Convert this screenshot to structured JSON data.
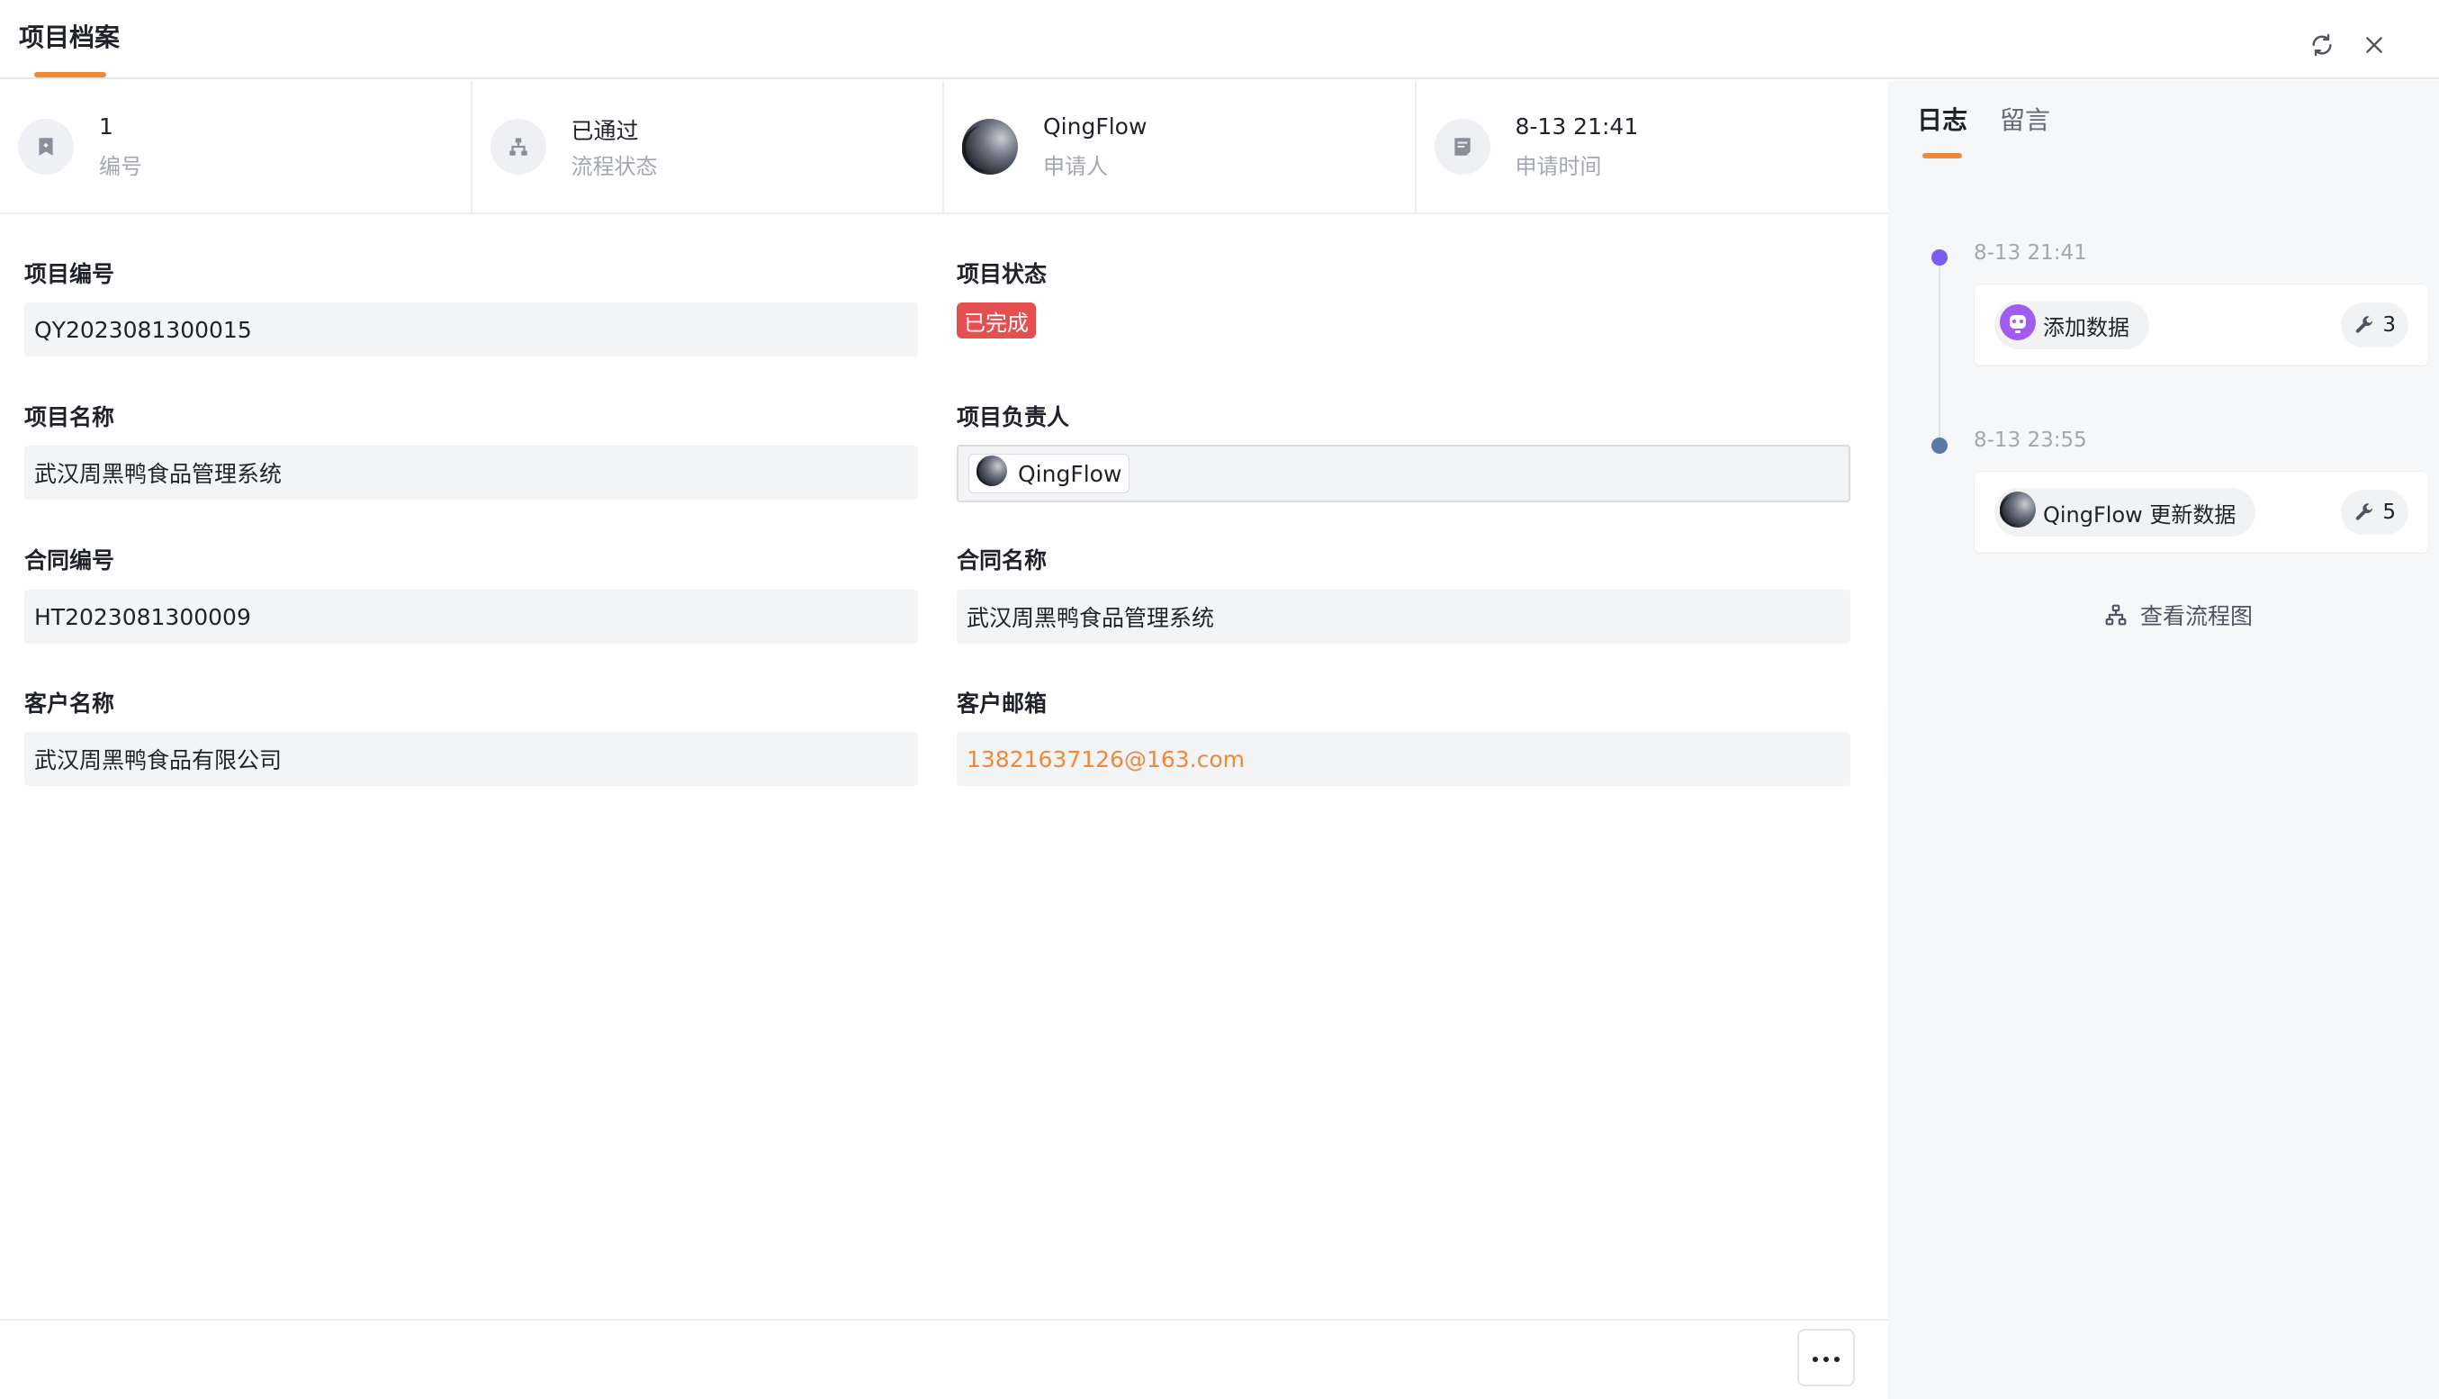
{
  "header": {
    "title": "项目档案",
    "refresh_icon": "refresh-icon",
    "close_icon": "close-icon"
  },
  "summary": [
    {
      "value": "1",
      "label": "编号",
      "icon": "tag-icon"
    },
    {
      "value": "已通过",
      "label": "流程状态",
      "icon": "flow-icon"
    },
    {
      "value": "QingFlow",
      "label": "申请人",
      "icon": "avatar"
    },
    {
      "value": "8-13 21:41",
      "label": "申请时间",
      "icon": "form-icon"
    }
  ],
  "fields": {
    "project_no": {
      "label": "项目编号",
      "value": "QY2023081300015"
    },
    "project_status": {
      "label": "项目状态",
      "value": "已完成"
    },
    "project_name": {
      "label": "项目名称",
      "value": "武汉周黑鸭食品管理系统"
    },
    "project_owner": {
      "label": "项目负责人",
      "value": "QingFlow"
    },
    "contract_no": {
      "label": "合同编号",
      "value": "HT2023081300009"
    },
    "contract_name": {
      "label": "合同名称",
      "value": "武汉周黑鸭食品管理系统"
    },
    "customer_name": {
      "label": "客户名称",
      "value": "武汉周黑鸭食品有限公司"
    },
    "customer_email": {
      "label": "客户邮箱",
      "value": "13821637126@163.com"
    }
  },
  "tabs": [
    {
      "label": "日志",
      "active": true
    },
    {
      "label": "留言",
      "active": false
    }
  ],
  "timeline": [
    {
      "time": "8-13 21:41",
      "action": "添加数据",
      "count": "3",
      "dot_color": "#7b5cf0",
      "actor_icon": "robot-icon"
    },
    {
      "time": "8-13 23:55",
      "action": "QingFlow 更新数据",
      "count": "5",
      "dot_color": "#5a77a6",
      "actor_icon": "avatar"
    }
  ],
  "flow_link": "查看流程图",
  "colors": {
    "accent": "#f0883a",
    "status_done": "#e45050",
    "email_link": "#f0883a"
  }
}
